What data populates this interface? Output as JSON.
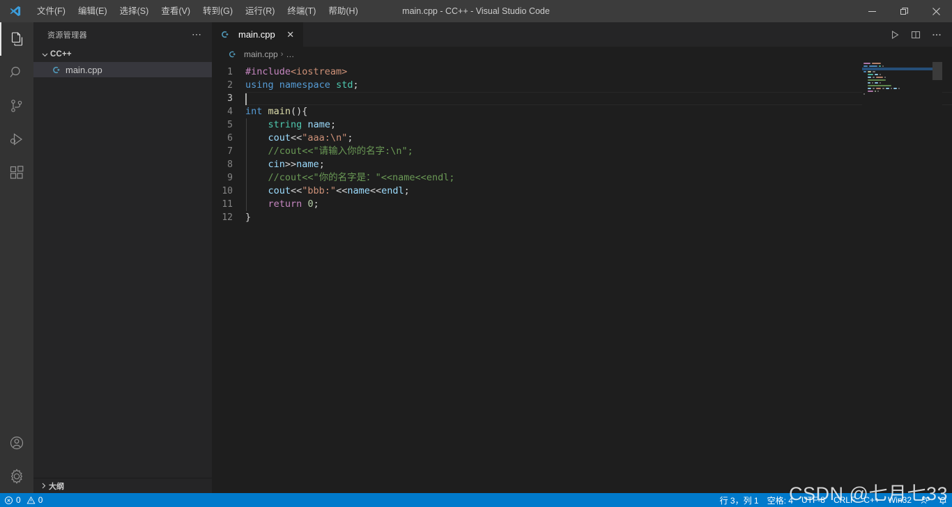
{
  "window": {
    "title": "main.cpp - CC++ - Visual Studio Code",
    "minimize_label": "─",
    "restore_label": "❐",
    "close_label": "✕"
  },
  "menu": {
    "items": [
      {
        "label": "文件(F)"
      },
      {
        "label": "编辑(E)"
      },
      {
        "label": "选择(S)"
      },
      {
        "label": "查看(V)"
      },
      {
        "label": "转到(G)"
      },
      {
        "label": "运行(R)"
      },
      {
        "label": "终端(T)"
      },
      {
        "label": "帮助(H)"
      }
    ]
  },
  "activity_bar": {
    "items": [
      {
        "name": "explorer",
        "title": "资源管理器",
        "active": true
      },
      {
        "name": "search",
        "title": "搜索",
        "active": false
      },
      {
        "name": "source-control",
        "title": "源代码管理",
        "active": false
      },
      {
        "name": "run-debug",
        "title": "运行和调试",
        "active": false
      },
      {
        "name": "extensions",
        "title": "扩展",
        "active": false
      }
    ],
    "bottom": [
      {
        "name": "account",
        "title": "帐户"
      },
      {
        "name": "settings",
        "title": "管理"
      }
    ]
  },
  "sidebar": {
    "header": "资源管理器",
    "more_actions": "⋯",
    "folder": {
      "label": "CC++",
      "expanded": true,
      "chevron": "⌄"
    },
    "files": [
      {
        "label": "main.cpp",
        "selected": true
      }
    ],
    "outline": {
      "label": "大纲",
      "chevron": "›"
    }
  },
  "editor": {
    "tab": {
      "label": "main.cpp",
      "close": "✕",
      "active": true
    },
    "actions": [
      {
        "name": "run-code",
        "label": "▷"
      },
      {
        "name": "split-editor",
        "label": "◫"
      },
      {
        "name": "more-actions",
        "label": "⋯"
      }
    ],
    "breadcrumb": {
      "file": "main.cpp",
      "separator": "›",
      "rest": "…"
    },
    "cursor_line": 3,
    "code": [
      {
        "num": 1,
        "indent": 0,
        "tokens": [
          {
            "t": "#include",
            "c": "t-pre"
          },
          {
            "t": "<iostream>",
            "c": "t-str"
          }
        ]
      },
      {
        "num": 2,
        "indent": 0,
        "tokens": [
          {
            "t": "using",
            "c": "t-key"
          },
          {
            "t": " ",
            "c": "t-plain"
          },
          {
            "t": "namespace",
            "c": "t-key"
          },
          {
            "t": " ",
            "c": "t-plain"
          },
          {
            "t": "std",
            "c": "t-ns"
          },
          {
            "t": ";",
            "c": "t-plain"
          }
        ]
      },
      {
        "num": 3,
        "indent": 0,
        "tokens": []
      },
      {
        "num": 4,
        "indent": 0,
        "tokens": [
          {
            "t": "int",
            "c": "t-key"
          },
          {
            "t": " ",
            "c": "t-plain"
          },
          {
            "t": "main",
            "c": "t-fn"
          },
          {
            "t": "(){",
            "c": "t-plain"
          }
        ]
      },
      {
        "num": 5,
        "indent": 1,
        "tokens": [
          {
            "t": "    ",
            "c": "t-plain"
          },
          {
            "t": "string",
            "c": "t-type"
          },
          {
            "t": " ",
            "c": "t-plain"
          },
          {
            "t": "name",
            "c": "t-var"
          },
          {
            "t": ";",
            "c": "t-plain"
          }
        ]
      },
      {
        "num": 6,
        "indent": 1,
        "tokens": [
          {
            "t": "    ",
            "c": "t-plain"
          },
          {
            "t": "cout",
            "c": "t-var"
          },
          {
            "t": "<<",
            "c": "t-plain"
          },
          {
            "t": "\"aaa:\\n\"",
            "c": "t-str"
          },
          {
            "t": ";",
            "c": "t-plain"
          }
        ]
      },
      {
        "num": 7,
        "indent": 1,
        "tokens": [
          {
            "t": "    ",
            "c": "t-plain"
          },
          {
            "t": "//cout<<\"请输入你的名字:\\n\";",
            "c": "t-cmt"
          }
        ]
      },
      {
        "num": 8,
        "indent": 1,
        "tokens": [
          {
            "t": "    ",
            "c": "t-plain"
          },
          {
            "t": "cin",
            "c": "t-var"
          },
          {
            "t": ">>",
            "c": "t-plain"
          },
          {
            "t": "name",
            "c": "t-var"
          },
          {
            "t": ";",
            "c": "t-plain"
          }
        ]
      },
      {
        "num": 9,
        "indent": 1,
        "tokens": [
          {
            "t": "    ",
            "c": "t-plain"
          },
          {
            "t": "//cout<<\"你的名字是：\"<<name<<endl;",
            "c": "t-cmt"
          }
        ]
      },
      {
        "num": 10,
        "indent": 1,
        "tokens": [
          {
            "t": "    ",
            "c": "t-plain"
          },
          {
            "t": "cout",
            "c": "t-var"
          },
          {
            "t": "<<",
            "c": "t-plain"
          },
          {
            "t": "\"bbb:\"",
            "c": "t-str"
          },
          {
            "t": "<<",
            "c": "t-plain"
          },
          {
            "t": "name",
            "c": "t-var"
          },
          {
            "t": "<<",
            "c": "t-plain"
          },
          {
            "t": "endl",
            "c": "t-var"
          },
          {
            "t": ";",
            "c": "t-plain"
          }
        ]
      },
      {
        "num": 11,
        "indent": 1,
        "tokens": [
          {
            "t": "    ",
            "c": "t-plain"
          },
          {
            "t": "return",
            "c": "t-key2"
          },
          {
            "t": " ",
            "c": "t-plain"
          },
          {
            "t": "0",
            "c": "t-num"
          },
          {
            "t": ";",
            "c": "t-plain"
          }
        ]
      },
      {
        "num": 12,
        "indent": 0,
        "tokens": [
          {
            "t": "}",
            "c": "t-plain"
          }
        ]
      }
    ]
  },
  "status_bar": {
    "errors": "0",
    "warnings": "0",
    "position": "行 3，列 1",
    "indentation": "空格: 4",
    "encoding": "UTF-8",
    "eol": "CRLF",
    "language": "C++",
    "platform": "Win32",
    "feedback_icon": "feedback-icon",
    "bell_icon": "bell-icon"
  },
  "watermark": "CSDN @七月七33",
  "colors": {
    "titlebar": "#3c3c3c",
    "activitybar": "#333333",
    "sidebar": "#252526",
    "editor": "#1e1e1e",
    "statusbar": "#007acc",
    "selection": "#37373d",
    "accent": "#007acc"
  }
}
